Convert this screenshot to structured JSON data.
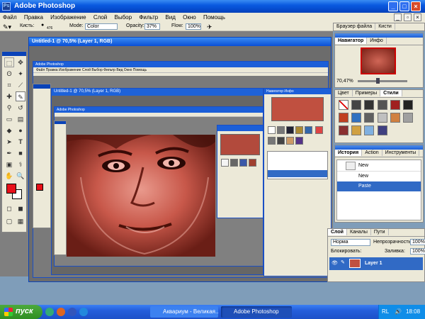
{
  "app": {
    "title": "Adobe Photoshop"
  },
  "menu": [
    "Файл",
    "Правка",
    "Изображение",
    "Слой",
    "Выбор",
    "Фильтр",
    "Вид",
    "Окно",
    "Помощь"
  ],
  "options": {
    "brush_label": "Кисть:",
    "brush_size": "476",
    "mode_label": "Mode:",
    "mode_value": "Color",
    "opacity_label": "Opacity:",
    "opacity_value": "37%",
    "flow_label": "Flow:",
    "flow_value": "100%"
  },
  "top_tabs": [
    "Браузер файла",
    "Кисти"
  ],
  "navigator": {
    "tabs": [
      "Навигатор",
      "Инфо"
    ],
    "zoom": "70,47%"
  },
  "styles": {
    "tabs": [
      "Цвет",
      "Примеры",
      "Стили"
    ]
  },
  "history": {
    "tabs": [
      "История",
      "Action",
      "Инструменты"
    ],
    "items": [
      "New",
      "New",
      "Paste"
    ]
  },
  "document": {
    "title": "Untitled-1 @ 70,5% (Layer 1, RGB)"
  },
  "layers": {
    "tabs": [
      "Слой",
      "Каналы",
      "Пути"
    ],
    "blend": "Норма",
    "opacity_label": "Непрозрачность:",
    "opacity_value": "100%",
    "lock_label": "Блокировать:",
    "fill_label": "Заливка:",
    "fill_value": "100%",
    "layer_name": "Layer 1"
  },
  "taskbar": {
    "start": "пуск",
    "tasks": [
      "Аквариум - Великая...",
      "Adobe Photoshop"
    ],
    "lang": "RL",
    "time": "18:08"
  },
  "colors": {
    "fg": "#e8101a",
    "bg": "#ffffff",
    "accent": "#0a43b8"
  }
}
